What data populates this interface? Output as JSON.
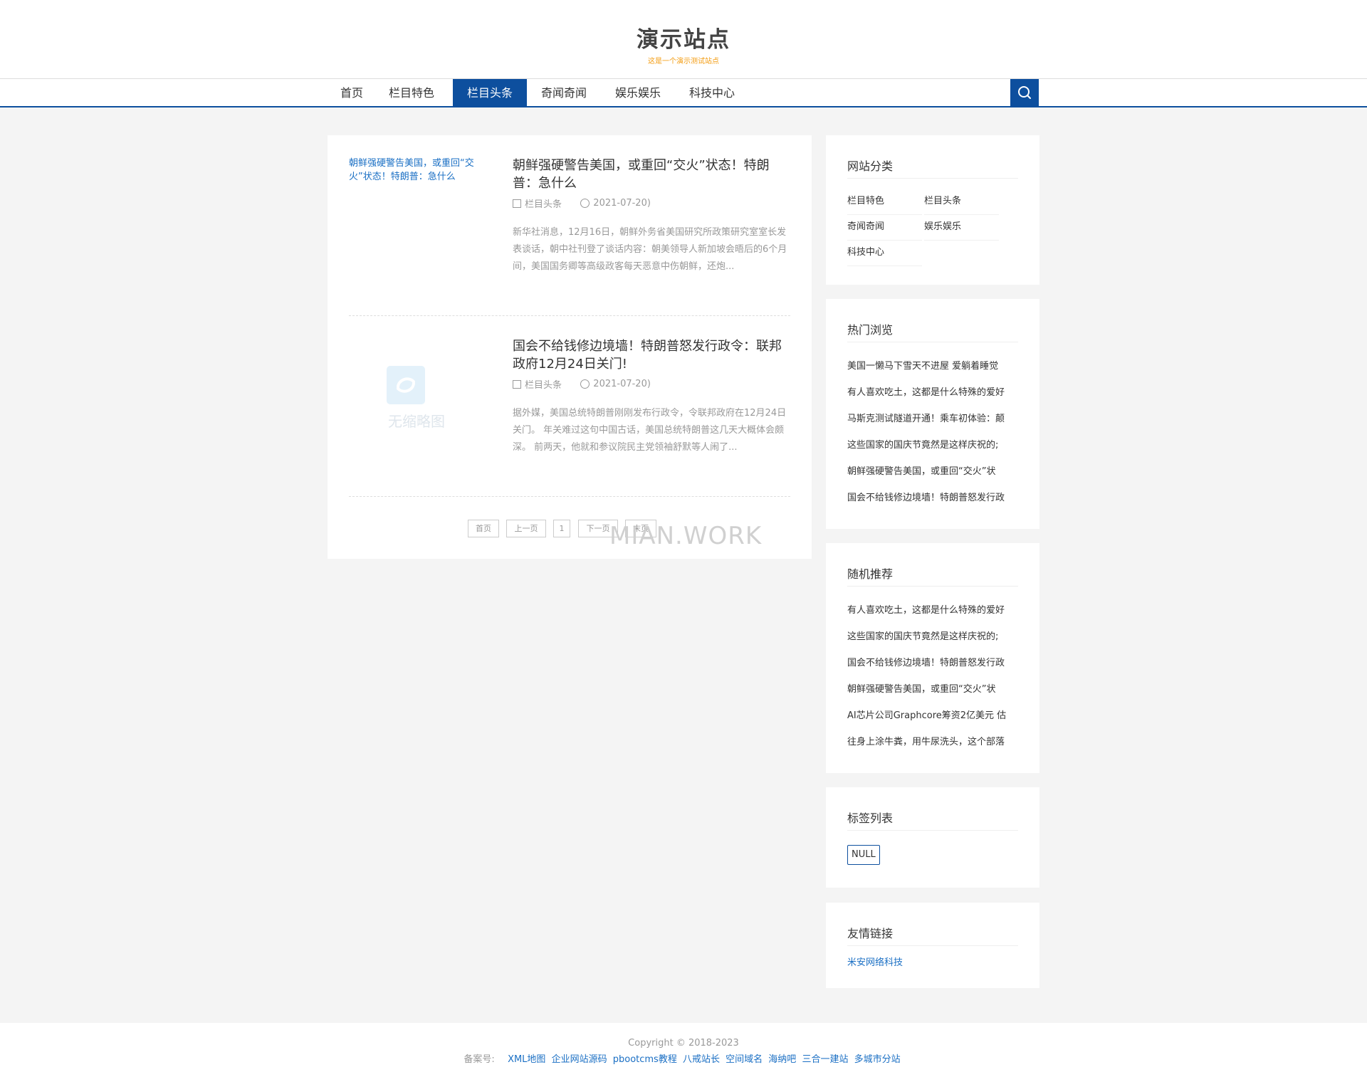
{
  "site": {
    "title": "演示站点",
    "subtitle": "这是一个演示测试站点"
  },
  "nav": {
    "items": [
      {
        "label": "首页"
      },
      {
        "label": "栏目特色"
      },
      {
        "label": "栏目头条"
      },
      {
        "label": "奇闻奇闻"
      },
      {
        "label": "娱乐娱乐"
      },
      {
        "label": "科技中心"
      }
    ],
    "active": "栏目头条",
    "search_icon": "search-icon"
  },
  "articles": [
    {
      "thumb_alt": "朝鲜强硬警告美国，或重回“交火”状态！特朗普：急什么",
      "title": "朝鲜强硬警告美国，或重回“交火”状态！特朗普：急什么",
      "category": "栏目头条",
      "date": "2021-07-20)",
      "desc": "新华社消息，12月16日，朝鲜外务省美国研究所政策研究室室长发表谈话，朝中社刊登了谈话内容：朝美领导人新加坡会晤后的6个月间，美国国务卿等高级政客每天恶意中伤朝鲜，还炮..."
    },
    {
      "thumb_placeholder": "无缩略图",
      "title": "国会不给钱修边境墙！特朗普怒发行政令：联邦政府12月24日关门!",
      "category": "栏目头条",
      "date": "2021-07-20)",
      "desc": "据外媒，美国总统特朗普刚刚发布行政令，令联邦政府在12月24日关门。 年关难过这句中国古话，美国总统特朗普这几天大概体会颇深。 前两天，他就和参议院民主党领袖舒默等人闹了..."
    }
  ],
  "pager": {
    "first": "首页",
    "prev": "上一页",
    "current": "1",
    "next": "下一页",
    "last": "末页"
  },
  "watermark": "MIAN.WORK",
  "sidebar": {
    "categories": {
      "title": "网站分类",
      "items": [
        "栏目特色",
        "栏目头条",
        "奇闻奇闻",
        "娱乐娱乐",
        "科技中心"
      ]
    },
    "hot": {
      "title": "热门浏览",
      "items": [
        "美国一懒马下雪天不进屋 爱躺着睡觉",
        "有人喜欢吃土，这都是什么特殊的爱好",
        "马斯克测试隧道开通！乘车初体验：颠",
        "这些国家的国庆节竟然是这样庆祝的;",
        "朝鲜强硬警告美国，或重回“交火”状",
        "国会不给钱修边境墙！特朗普怒发行政"
      ]
    },
    "random": {
      "title": "随机推荐",
      "items": [
        "有人喜欢吃土，这都是什么特殊的爱好",
        "这些国家的国庆节竟然是这样庆祝的;",
        "国会不给钱修边境墙！特朗普怒发行政",
        "朝鲜强硬警告美国，或重回“交火”状",
        "AI芯片公司Graphcore筹资2亿美元 估",
        "往身上涂牛粪，用牛尿洗头，这个部落"
      ]
    },
    "tags": {
      "title": "标签列表",
      "items": [
        "NULL"
      ]
    },
    "links": {
      "title": "友情链接",
      "items": [
        "米安网络科技"
      ]
    }
  },
  "footer": {
    "copyright": "Copyright © 2018-2023",
    "record_label": "备案号:",
    "links": [
      "XML地图",
      "企业网站源码",
      "pbootcms教程",
      "八戒站长",
      "空间域名",
      "海纳吧",
      "三合一建站",
      "多城市分站"
    ]
  },
  "colors": {
    "brand": "#0d4f9e",
    "link": "#1a6fc4",
    "accent": "#f39c12"
  }
}
